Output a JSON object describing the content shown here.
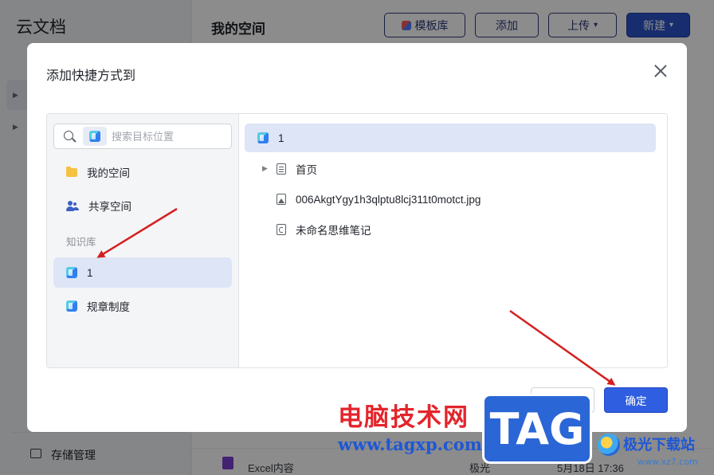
{
  "app": {
    "title": "云文档",
    "storage_label": "存储管理"
  },
  "main": {
    "title": "我的空间",
    "toolbar": {
      "template_label": "模板库",
      "add_label": "添加",
      "upload_label": "上传",
      "new_label": "新建"
    },
    "bottom_row": {
      "name": "Excel内容",
      "owner": "极光",
      "time": "5月18日 17:36"
    }
  },
  "dialog": {
    "title": "添加快捷方式到",
    "search": {
      "placeholder": "搜索目标位置"
    },
    "nav": {
      "my_space": "我的空间",
      "shared_space": "共享空间",
      "kb_section": "知识库",
      "kb_items": [
        "1",
        "规章制度"
      ]
    },
    "tree": {
      "root": "1",
      "items": [
        "首页",
        "006AkgtYgy1h3qlptu8lcj311t0motct.jpg",
        "未命名思维笔记"
      ]
    },
    "buttons": {
      "cancel": "取消",
      "ok": "确定"
    }
  },
  "watermark": {
    "brand": "电脑技术网",
    "url": "www.tagxp.com",
    "tag": "TAG",
    "site": "极光下载站",
    "site_url": "www.xz7.com"
  },
  "colors": {
    "primary": "#2f5fe0",
    "selection": "#dde5f6",
    "annotation_arrow": "#d42020"
  }
}
